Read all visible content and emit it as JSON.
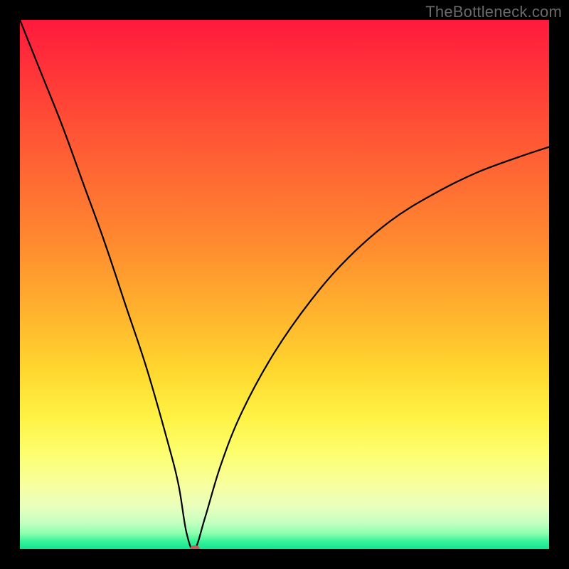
{
  "watermark": "TheBottleneck.com",
  "colors": {
    "frame": "#000000",
    "curve": "#000000",
    "dot": "#c06058",
    "gradient_top": "#ff1a3c",
    "gradient_bottom": "#11e58f"
  },
  "chart_data": {
    "type": "line",
    "title": "",
    "xlabel": "",
    "ylabel": "",
    "xlim": [
      0,
      100
    ],
    "ylim": [
      0,
      100
    ],
    "notes": "Bottleneck-style V-curve. Y = bottleneck severity (0 at green bottom, 100 at red top). Minimum (optimal point) occurs near x ≈ 33.",
    "minimum": {
      "x": 33,
      "y": 0
    },
    "series": [
      {
        "name": "bottleneck-curve",
        "x": [
          0,
          4,
          8,
          12,
          16,
          20,
          24,
          28,
          30,
          31.5,
          33,
          35,
          38,
          42,
          48,
          55,
          62,
          70,
          78,
          86,
          94,
          100
        ],
        "y": [
          100,
          90,
          80,
          69,
          58,
          46,
          34,
          20,
          12,
          3,
          0,
          6,
          16,
          26,
          37,
          47,
          55,
          62,
          67,
          71,
          74,
          76
        ]
      }
    ]
  }
}
